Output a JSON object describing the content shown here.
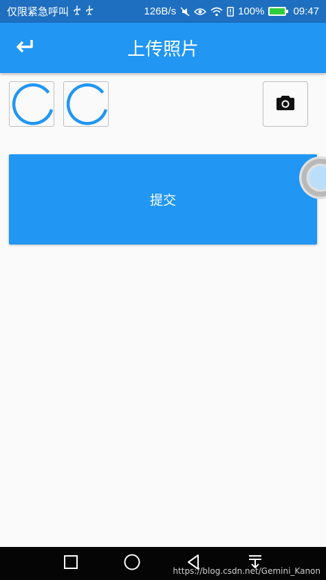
{
  "status_bar": {
    "left_text": "仅限紧急呼叫",
    "network_speed": "126B/s",
    "battery_percent": "100%",
    "time": "09:47"
  },
  "app_bar": {
    "title": "上传照片",
    "back_icon": "back-arrow-icon"
  },
  "photos": [
    {
      "state": "loading"
    },
    {
      "state": "loading"
    }
  ],
  "camera_button": {
    "icon": "camera-icon"
  },
  "submit_button": {
    "label": "提交"
  },
  "colors": {
    "primary": "#2196f3",
    "status_bar": "#1e6fbf",
    "background": "#fafafa",
    "nav_bar": "#050505"
  },
  "watermark": "https://blog.csdn.net/Gemini_Kanon"
}
